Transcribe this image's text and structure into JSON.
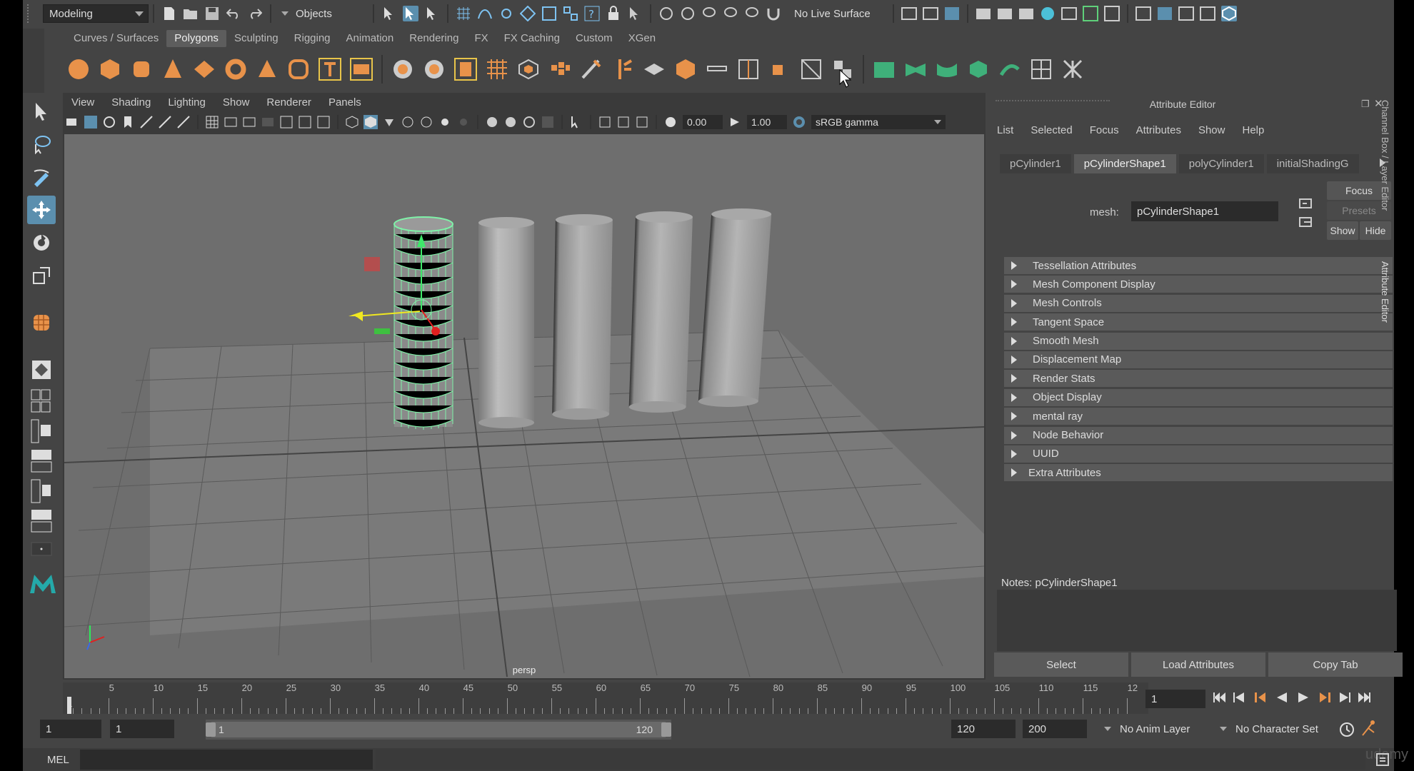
{
  "status_line": {
    "mode_menu": "Modeling",
    "selection_mode": "Objects",
    "live_surface": "No Live Surface"
  },
  "shelf": {
    "tabs": [
      "Curves / Surfaces",
      "Polygons",
      "Sculpting",
      "Rigging",
      "Animation",
      "Rendering",
      "FX",
      "FX Caching",
      "Custom",
      "XGen"
    ],
    "active_tab": "Polygons",
    "icons": [
      "poly-sphere-icon",
      "poly-cube-icon",
      "poly-cylinder-icon",
      "poly-cone-icon",
      "poly-plane-icon",
      "poly-torus-icon",
      "poly-pyramid-icon",
      "poly-pipe-icon",
      "type-icon",
      "svg-icon",
      "combine-icon",
      "separate-icon",
      "mirror-icon",
      "smooth-icon",
      "bridge-icon",
      "extrude-icon",
      "bevel-icon",
      "multi-cut-icon",
      "target-weld-icon",
      "append-icon",
      "fill-hole-icon",
      "insert-edge-loop-icon",
      "make-hole-icon",
      "quad-draw-icon",
      "uv-editor-icon",
      "planar-map-icon",
      "automatic-map-icon",
      "cylindrical-map-icon",
      "spherical-map-icon",
      "camera-map-icon",
      "unfold-icon",
      "layout-icon"
    ]
  },
  "viewport": {
    "menus": [
      "View",
      "Shading",
      "Lighting",
      "Show",
      "Renderer",
      "Panels"
    ],
    "exposure": "0.00",
    "gamma": "1.00",
    "color_space": "sRGB gamma",
    "camera_label": "persp"
  },
  "attribute_editor": {
    "title": "Attribute Editor",
    "menus": [
      "List",
      "Selected",
      "Focus",
      "Attributes",
      "Show",
      "Help"
    ],
    "tabs": [
      "pCylinder1",
      "pCylinderShape1",
      "polyCylinder1",
      "initialShadingG"
    ],
    "active_tab": "pCylinderShape1",
    "mesh_label": "mesh:",
    "mesh_value": "pCylinderShape1",
    "focus_btn": "Focus",
    "presets_btn": "Presets",
    "show_btn": "Show",
    "hide_btn": "Hide",
    "sections": [
      "Tessellation Attributes",
      "Mesh Component Display",
      "Mesh Controls",
      "Tangent Space",
      "Smooth Mesh",
      "Displacement Map",
      "Render Stats",
      "Object Display",
      "mental ray",
      "Node Behavior",
      "UUID",
      "Extra Attributes"
    ],
    "notes_label": "Notes:  pCylinderShape1",
    "bottom_buttons": [
      "Select",
      "Load Attributes",
      "Copy Tab"
    ],
    "side_tabs": [
      "Channel Box / Layer Editor",
      "Attribute Editor"
    ]
  },
  "time_slider": {
    "tick_labels": [
      "5",
      "10",
      "15",
      "20",
      "25",
      "30",
      "35",
      "40",
      "45",
      "50",
      "55",
      "60",
      "65",
      "70",
      "75",
      "80",
      "85",
      "90",
      "95",
      "100",
      "105",
      "110",
      "115",
      "12"
    ],
    "first_label": "1",
    "current_frame": "1"
  },
  "range_slider": {
    "start_time": "1",
    "playback_start": "1",
    "range_start": "1",
    "range_end": "120",
    "playback_end": "120",
    "end_time": "200",
    "anim_layer": "No Anim Layer",
    "character_set": "No Character Set"
  },
  "command_line": {
    "language": "MEL"
  },
  "watermark": "udemy",
  "colors": {
    "accent": "#5b8fae",
    "selection_wire": "#7ff2a8",
    "panel": "#444444",
    "viewport_bg": "#6e6e6e"
  }
}
